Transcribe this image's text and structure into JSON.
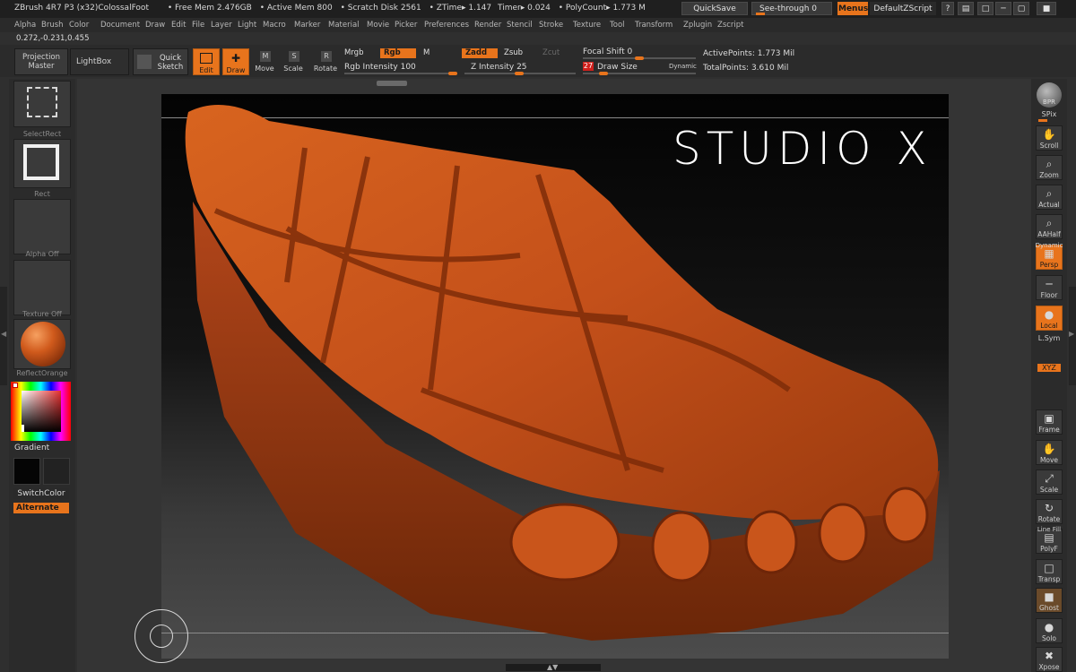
{
  "titlebar": {
    "app_title": "ZBrush 4R7 P3 (x32)ColossalFoot",
    "free_mem": "• Free Mem 2.476GB",
    "active_mem": "• Active Mem 800",
    "scratch_disk": "• Scratch Disk 2561",
    "ztime": "• ZTime▸ 1.147",
    "timer": "Timer▸ 0.024",
    "polycount": "• PolyCount▸ 1.773 M",
    "quicksave": "QuickSave",
    "see_through": "See-through  0",
    "menus": "Menus",
    "default_zscript": "DefaultZScript"
  },
  "menubar": {
    "items": [
      "Alpha",
      "Brush",
      "Color",
      "Document",
      "Draw",
      "Edit",
      "File",
      "Layer",
      "Light",
      "Macro",
      "Marker",
      "Material",
      "Movie",
      "Picker",
      "Preferences",
      "Render",
      "Stencil",
      "Stroke",
      "Texture",
      "Tool",
      "Transform",
      "Zplugin",
      "Zscript"
    ]
  },
  "coords": "0.272,-0.231,0.455",
  "toolbar": {
    "projection_master": "Projection Master",
    "lightbox": "LightBox",
    "quick_sketch": "Quick Sketch",
    "edit": "Edit",
    "draw": "Draw",
    "move": "Move",
    "scale": "Scale",
    "rotate": "Rotate",
    "mrgb": "Mrgb",
    "rgb": "Rgb",
    "m": "M",
    "rgb_intensity_label": "Rgb  Intensity",
    "rgb_intensity_value": "100",
    "zadd": "Zadd",
    "zsub": "Zsub",
    "zcut": "Zcut",
    "z_intensity_label": "Z Intensity",
    "z_intensity_value": "25",
    "focal_shift_label": "Focal  Shift",
    "focal_shift_value": "0",
    "draw_size_label": "Draw  Size",
    "draw_size_value": "27",
    "dynamic": "Dynamic",
    "active_points": "ActivePoints: 1.773  Mil",
    "total_points": "TotalPoints: 3.610  Mil"
  },
  "leftpanel": {
    "select_rect": "SelectRect",
    "rect": "Rect",
    "alpha_off": "Alpha  Off",
    "texture_off": "Texture  Off",
    "material": "ReflectOrange",
    "gradient": "Gradient",
    "switch_color": "SwitchColor",
    "alternate": "Alternate"
  },
  "viewport": {
    "watermark": "STUDIO X"
  },
  "rightshelf": {
    "bpr": "BPR",
    "spix": "SPix",
    "items": [
      "Scroll",
      "Zoom",
      "Actual",
      "AAHalf",
      "Persp",
      "Floor",
      "Local",
      "L.Sym",
      "XYZ",
      "Frame",
      "Move",
      "Scale",
      "Rotate",
      "PolyF",
      "Transp",
      "Ghost",
      "Solo",
      "Xpose"
    ],
    "dynamic_label": "Dynamic",
    "line_fill": "Line Fill"
  },
  "colors": {
    "accent": "#e8741c",
    "background": "#2f2f2f",
    "model": "#c8531a"
  }
}
